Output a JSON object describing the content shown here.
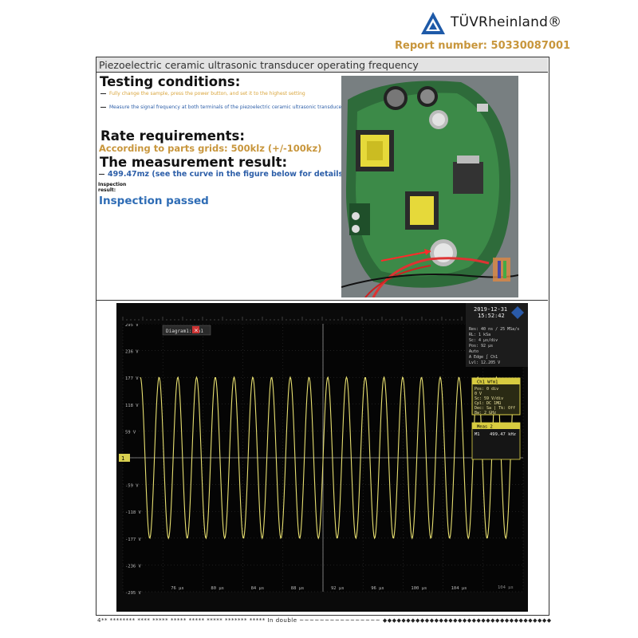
{
  "header": {
    "brand": "TÜVRheinland®",
    "report_number": "Report number: 50330087001"
  },
  "section": {
    "title": "Piezoelectric ceramic ultrasonic transducer operating frequency",
    "testing_heading": "Testing conditions:",
    "testing_items": [
      "Fully change the sample, press the power button, and set it to the highest setting",
      "Measure the signal frequency at both terminals of the piezoelectric ceramic ultrasonic transducer"
    ],
    "rate_heading": "Rate requirements:",
    "rate_value": "According to parts grids: 500klz (+/-100kz)",
    "measurement_heading": "The measurement result:",
    "measurement_value": "499.47mz (see the curve in the figure below for details)",
    "inspection_label_1": "Inspection",
    "inspection_label_2": "result:",
    "inspection_result": "Inspection passed"
  },
  "colors": {
    "report_number": "#c8963c",
    "rate_value": "#c8963c",
    "measurement_value": "#2c5ea8",
    "inspection_result": "#2e6cb5",
    "testing_item_1": "#d9a53c",
    "testing_item_2": "#2c5ea8",
    "trace": "#e8e070"
  },
  "oscilloscope": {
    "datetime_date": "2019-12-31",
    "datetime_time": "15:52:42",
    "diagram_label": "Diagram1: Ch1",
    "y_ticks": [
      "295 V",
      "236 V",
      "177 V",
      "118 V",
      "59 V",
      "",
      "-59 V",
      "-118 V",
      "-177 V",
      "-236 V",
      "-295 V"
    ],
    "x_ticks": [
      "76 µs",
      "80 µs",
      "84 µs",
      "88 µs",
      "92 µs",
      "96 µs",
      "100 µs",
      "104 µs"
    ],
    "acq_panel": [
      "Res: 40 ns / 25 MSa/s",
      "RL: 1 kSa",
      "Sc: 4 µs/div",
      "Pos: 92 µs",
      "Auto",
      "A  Edge  ∫  Ch1",
      "Lvl: 12.205 V"
    ],
    "ch1_title": "Ch1 Wfm1",
    "ch1_panel": [
      "Pos: 0 div",
      "   0 V",
      "Sc: 59 V/div",
      "Cpl: DC 1MΩ",
      "Dec: Sa | Tk: Off",
      "Bw: 2 GHz"
    ],
    "meas_title": "Meas 2",
    "meas_label": "M1",
    "meas_value": "499.47 kHz",
    "corner_text": "104 µs",
    "ch_marker": "1",
    "cycles": 20
  },
  "footer": {
    "text": "4** ******** **** ***** ***** ***** ***** ******* *****  In double  ~~~~~~~~~~~~~~~~   ◆◆◆◆◆◆◆◆◆◆◆◆◆◆◆◆◆◆◆◆◆◆◆◆◆◆◆◆◆◆◆◆◆◆◆◆"
  }
}
